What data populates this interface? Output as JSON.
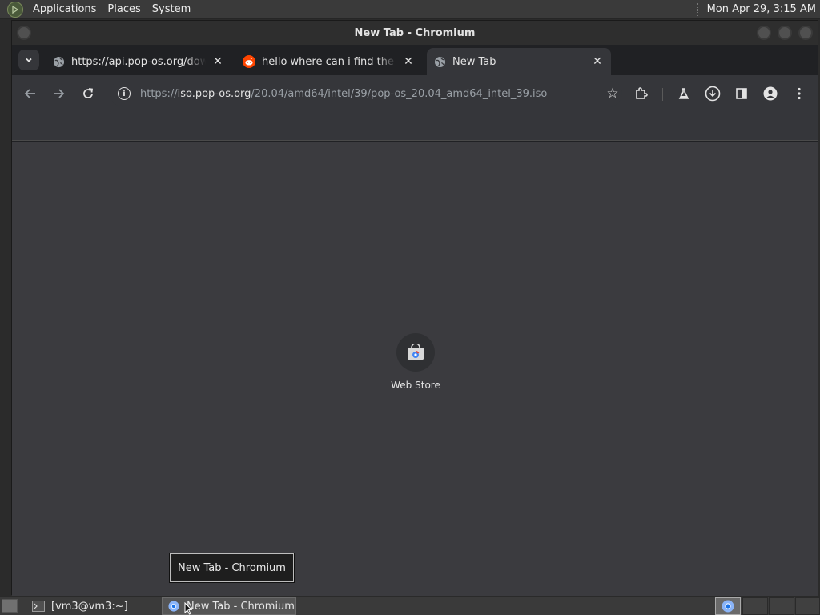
{
  "top_panel": {
    "menus": [
      "Applications",
      "Places",
      "System"
    ],
    "clock": "Mon Apr 29,  3:15 AM"
  },
  "window": {
    "title": "New Tab - Chromium"
  },
  "tabs": [
    {
      "label": "https://api.pop-os.org/download",
      "icon": "globe-icon",
      "active": false
    },
    {
      "label": "hello where can i find the link",
      "icon": "reddit-icon",
      "active": false
    },
    {
      "label": "New Tab",
      "icon": "globe-icon",
      "active": true
    }
  ],
  "toolbar": {
    "url_prefix": "https://",
    "url_host": "iso.pop-os.org",
    "url_path": "/20.04/amd64/intel/39/pop-os_20.04_amd64_intel_39.iso"
  },
  "content": {
    "shortcut_label": "Web Store"
  },
  "tooltip": {
    "text": "New Tab - Chromium"
  },
  "taskbar": {
    "tasks": [
      {
        "label": "[vm3@vm3:~]",
        "icon": "terminal-icon"
      },
      {
        "label": "New Tab - Chromium",
        "icon": "chromium-icon",
        "active": true
      }
    ]
  },
  "colors": {
    "panel": "#3a3a3a",
    "browser_frame": "#202124",
    "toolbar": "#35363a",
    "ntp_background": "#3b3b3f"
  }
}
